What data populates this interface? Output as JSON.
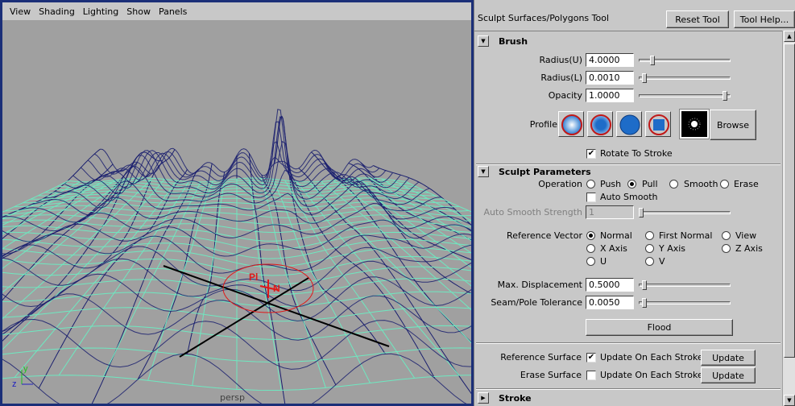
{
  "viewport": {
    "menus": [
      "View",
      "Shading",
      "Lighting",
      "Show",
      "Panels"
    ],
    "camera_label": "persp",
    "manip_labels": [
      "Pl",
      "N"
    ],
    "axis_y": "y",
    "axis_z": "z"
  },
  "panel": {
    "title": "Sculpt Surfaces/Polygons Tool",
    "reset_label": "Reset Tool",
    "help_label": "Tool Help...",
    "brush": {
      "title": "Brush",
      "radius_u_label": "Radius(U)",
      "radius_u_value": "4.0000",
      "radius_u_fraction": 0.1,
      "radius_l_label": "Radius(L)",
      "radius_l_value": "0.0010",
      "radius_l_fraction": 0.0,
      "opacity_label": "Opacity",
      "opacity_value": "1.0000",
      "opacity_fraction": 1.0,
      "profile_label": "Profile",
      "browse_label": "Browse",
      "rotate_label": "Rotate To Stroke",
      "rotate_checked": true
    },
    "sculpt": {
      "title": "Sculpt Parameters",
      "operation_label": "Operation",
      "operations": [
        "Push",
        "Pull",
        "Smooth",
        "Erase"
      ],
      "operation_selected": "Pull",
      "auto_smooth_label": "Auto Smooth",
      "auto_smooth_checked": false,
      "auto_strength_label": "Auto Smooth Strength",
      "auto_strength_value": "1",
      "ref_vector_label": "Reference Vector",
      "ref_options": [
        "Normal",
        "First Normal",
        "View",
        "X Axis",
        "Y Axis",
        "Z Axis",
        "U",
        "V"
      ],
      "ref_selected": "Normal",
      "max_disp_label": "Max. Displacement",
      "max_disp_value": "0.5000",
      "max_disp_fraction": 0.0,
      "seam_label": "Seam/Pole Tolerance",
      "seam_value": "0.0050",
      "seam_fraction": 0.0,
      "flood_label": "Flood",
      "ref_surface_label": "Reference Surface",
      "erase_surface_label": "Erase Surface",
      "update_each_label": "Update On Each Stroke",
      "update_label": "Update"
    },
    "stroke": {
      "title": "Stroke"
    }
  },
  "colors": {
    "viewport_bg": "#a0a0a0",
    "wire_blue": "#1a1f6e",
    "wire_green": "#6ee8c0",
    "brush_red": "#e01818",
    "active_border": "#1b2f78"
  }
}
